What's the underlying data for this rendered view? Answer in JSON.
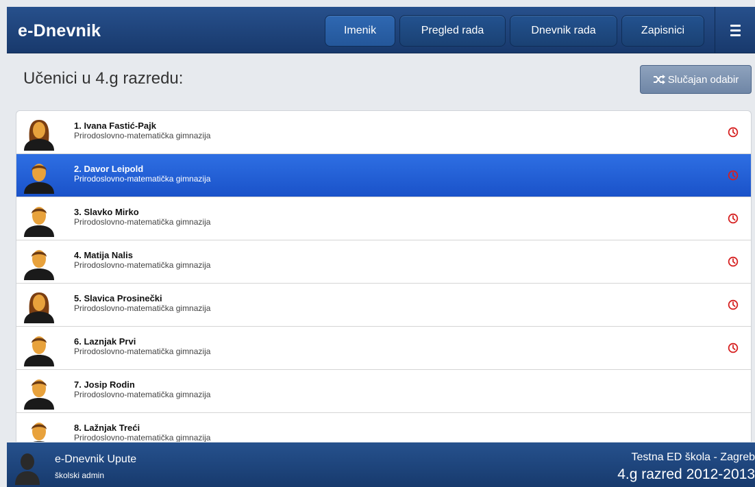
{
  "app": {
    "title": "e-Dnevnik"
  },
  "nav": {
    "items": [
      {
        "label": "Imenik",
        "active": true
      },
      {
        "label": "Pregled rada",
        "active": false
      },
      {
        "label": "Dnevnik rada",
        "active": false
      },
      {
        "label": "Zapisnici",
        "active": false
      }
    ],
    "menu_icon": "hamburger-menu-icon"
  },
  "page": {
    "title": "Učenici u 4.g razredu:",
    "random_button": {
      "label": "Slučajan odabir",
      "icon": "shuffle-icon"
    }
  },
  "students": [
    {
      "label": "1. Ivana Fastić-Pajk",
      "school": "Prirodoslovno-matematička gimnazija",
      "gender": "female",
      "clock": true,
      "selected": false
    },
    {
      "label": "2. Davor Leipold",
      "school": "Prirodoslovno-matematička gimnazija",
      "gender": "male",
      "clock": true,
      "selected": true
    },
    {
      "label": "3. Slavko Mirko",
      "school": "Prirodoslovno-matematička gimnazija",
      "gender": "male",
      "clock": true,
      "selected": false
    },
    {
      "label": "4. Matija Nalis",
      "school": "Prirodoslovno-matematička gimnazija",
      "gender": "male",
      "clock": true,
      "selected": false
    },
    {
      "label": "5. Slavica Prosinečki",
      "school": "Prirodoslovno-matematička gimnazija",
      "gender": "female",
      "clock": true,
      "selected": false
    },
    {
      "label": "6. Laznjak Prvi",
      "school": "Prirodoslovno-matematička gimnazija",
      "gender": "male",
      "clock": true,
      "selected": false
    },
    {
      "label": "7. Josip Rodin",
      "school": "Prirodoslovno-matematička gimnazija",
      "gender": "male",
      "clock": false,
      "selected": false
    },
    {
      "label": "8. Lažnjak Treći",
      "school": "Prirodoslovno-matematička gimnazija",
      "gender": "male",
      "clock": false,
      "selected": false
    }
  ],
  "footer": {
    "help_link": "e-Dnevnik Upute",
    "role": "školski admin",
    "school": "Testna ED škola - Zagreb",
    "class_year": "4.g razred 2012-2013"
  },
  "colors": {
    "header": "#1f4a82",
    "selected_row": "#2462d6",
    "clock": "#d62020"
  }
}
